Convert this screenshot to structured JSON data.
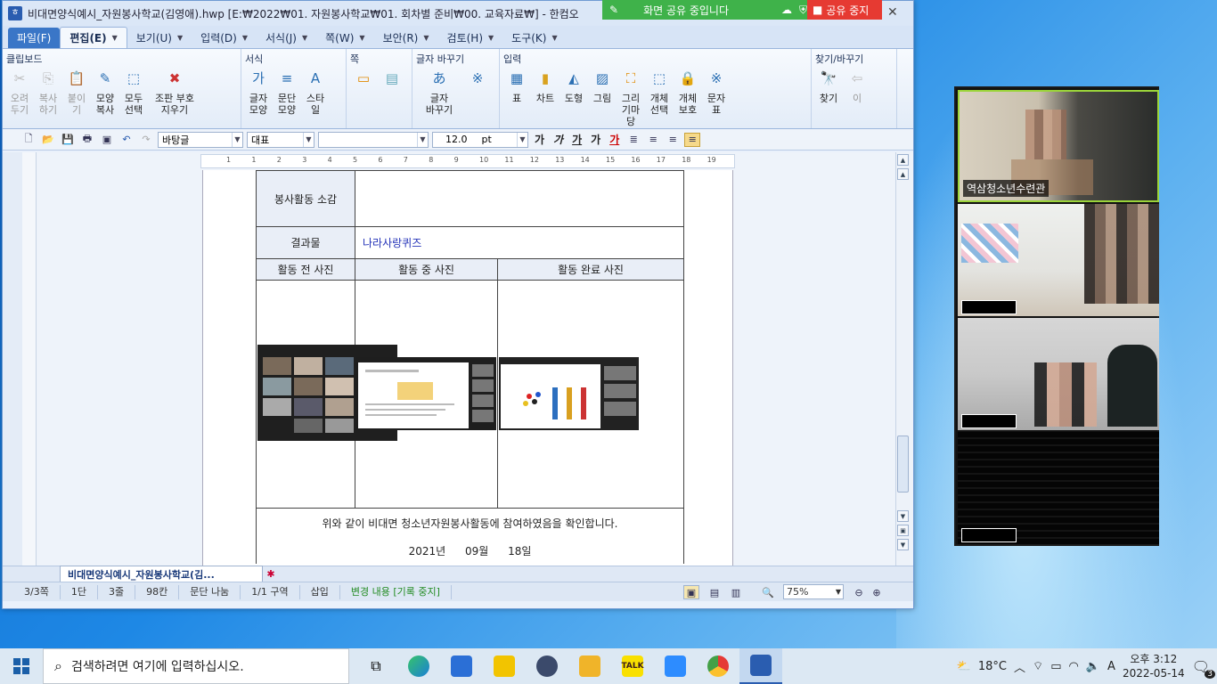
{
  "window": {
    "title": "비대면양식예시_자원봉사학교(김영애).hwp [E:₩2022₩01. 자원봉사학교₩01. 회차별 준비₩00. 교육자료₩] - 한컴오",
    "close_glyph": "✕"
  },
  "share_banner": {
    "status": "화면 공유 중입니다",
    "stop_label": "공유 중지"
  },
  "menu": {
    "tabs": [
      {
        "label": "파일(F)"
      },
      {
        "label": "편집(E)"
      },
      {
        "label": "보기(U)"
      },
      {
        "label": "입력(D)"
      },
      {
        "label": "서식(J)"
      },
      {
        "label": "쪽(W)"
      },
      {
        "label": "보안(R)"
      },
      {
        "label": "검토(H)"
      },
      {
        "label": "도구(K)"
      }
    ],
    "help": "?"
  },
  "ribbon": {
    "groups": [
      {
        "title": "클립보드",
        "items": [
          {
            "label": "오려\n두기",
            "icon": "scissors-icon",
            "glyph": "✂",
            "enabled": false
          },
          {
            "label": "복사하기",
            "icon": "copy-icon",
            "glyph": "⎘",
            "enabled": false
          },
          {
            "label": "붙이기",
            "icon": "paste-icon",
            "glyph": "📋",
            "enabled": false
          },
          {
            "label": "모양\n복사",
            "icon": "format-painter-icon",
            "glyph": "✎",
            "enabled": true
          },
          {
            "label": "모두\n선택",
            "icon": "select-all-icon",
            "glyph": "⬚",
            "enabled": true
          },
          {
            "label": "조판 부호\n지우기",
            "icon": "clear-codes-icon",
            "glyph": "✖",
            "enabled": true
          }
        ]
      },
      {
        "title": "서식",
        "items": [
          {
            "label": "글자\n모양",
            "icon": "char-shape-icon",
            "glyph": "가",
            "enabled": true
          },
          {
            "label": "문단\n모양",
            "icon": "para-shape-icon",
            "glyph": "≡",
            "enabled": true
          },
          {
            "label": "스타일",
            "icon": "style-icon",
            "glyph": "A",
            "enabled": true
          }
        ]
      },
      {
        "title": "쪽",
        "items": [
          {
            "label": "",
            "icon": "page-icon",
            "glyph": "▭",
            "enabled": true
          },
          {
            "label": "",
            "icon": "page-layout-icon",
            "glyph": "▤",
            "enabled": true
          }
        ]
      },
      {
        "title": "글자 바꾸기",
        "items": [
          {
            "label": "글자\n바꾸기",
            "icon": "char-replace-icon",
            "glyph": "あ",
            "enabled": true
          },
          {
            "label": "",
            "icon": "hanja-icon",
            "glyph": "※",
            "enabled": true
          }
        ]
      },
      {
        "title": "입력",
        "items": [
          {
            "label": "표",
            "icon": "table-icon",
            "glyph": "▦",
            "enabled": true
          },
          {
            "label": "차트",
            "icon": "chart-icon",
            "glyph": "▮",
            "enabled": true
          },
          {
            "label": "도형",
            "icon": "shape-icon",
            "glyph": "◭",
            "enabled": true
          },
          {
            "label": "그림",
            "icon": "picture-icon",
            "glyph": "▨",
            "enabled": true
          },
          {
            "label": "그리기마당",
            "icon": "clipart-icon",
            "glyph": "⛶",
            "enabled": true
          },
          {
            "label": "개체\n선택",
            "icon": "object-select-icon",
            "glyph": "⬚",
            "enabled": true
          },
          {
            "label": "개체\n보호",
            "icon": "object-protect-icon",
            "glyph": "🔒",
            "enabled": true
          },
          {
            "label": "문자표",
            "icon": "symbol-icon",
            "glyph": "※",
            "enabled": true
          }
        ]
      },
      {
        "title": "찾기/바꾸기",
        "items": [
          {
            "label": "찾기",
            "icon": "find-icon",
            "glyph": "🔭",
            "enabled": true
          },
          {
            "label": "이",
            "icon": "prev-icon",
            "glyph": "⇦",
            "enabled": false
          }
        ]
      }
    ]
  },
  "format_bar": {
    "style": "바탕글",
    "lang": "대표",
    "font": "",
    "size": "12.0",
    "unit": "pt",
    "buttons": [
      "가",
      "가",
      "가",
      "가",
      "가"
    ]
  },
  "ruler": {
    "marks": [
      "1",
      "1",
      "2",
      "3",
      "4",
      "5",
      "6",
      "7",
      "8",
      "9",
      "10",
      "11",
      "12",
      "13",
      "14",
      "15",
      "16",
      "17",
      "18",
      "19"
    ]
  },
  "document": {
    "row_impression_label": "봉사활동 소감",
    "row_result_label": "결과물",
    "row_result_value": "나라사랑퀴즈",
    "photo_headers": [
      "활동 전 사진",
      "활동 중 사진",
      "활동 완료 사진"
    ],
    "confirm_text": "위와 같이 비대면 청소년자원봉사활동에 참여하였음을 확인합니다.",
    "year": "2021년",
    "month": "09월",
    "day": "18일"
  },
  "tabbar": {
    "doc_tab": "비대면양식예시_자원봉사학교(김..."
  },
  "status": {
    "page": "3/3쪽",
    "column": "1단",
    "line": "3줄",
    "char": "98칸",
    "break": "문단 나눔",
    "section": "1/1 구역",
    "mode": "삽입",
    "track": "변경 내용 [기록 중지]",
    "zoom": "75%"
  },
  "video": {
    "participants": [
      {
        "name": "역삼청소년수련관"
      },
      {
        "name": ""
      },
      {
        "name": ""
      },
      {
        "name": ""
      }
    ]
  },
  "taskbar": {
    "search_placeholder": "검색하려면 여기에 입력하십시오.",
    "weather": "18°C",
    "time": "오후 3:12",
    "date": "2022-05-14",
    "notifications": "3",
    "kakao_label": "TALK"
  }
}
